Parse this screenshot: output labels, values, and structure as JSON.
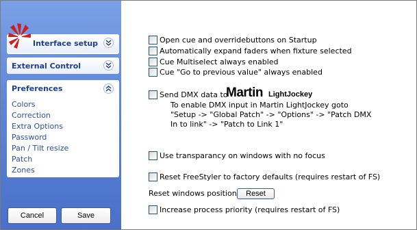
{
  "sidebar": {
    "panels": {
      "interface": {
        "title": "Interface setup",
        "expanded": false
      },
      "external": {
        "title": "External Control",
        "expanded": false
      },
      "preferences": {
        "title": "Preferences",
        "expanded": true,
        "items": [
          "Colors",
          "Correction",
          "Extra Options",
          "Password",
          "Pan / Tilt resize",
          "Patch",
          "Zones"
        ]
      }
    },
    "buttons": {
      "cancel": "Cancel",
      "save": "Save"
    }
  },
  "options": [
    {
      "label": "Open cue and overridebuttons on Startup",
      "checked": false
    },
    {
      "label": "Automatically expand faders when fixture selected",
      "checked": false
    },
    {
      "label": "Cue Multiselect always enabled",
      "checked": false
    },
    {
      "label": "Cue \"Go to previous value\" always enabled",
      "checked": false
    },
    {
      "label": "Send DMX data to",
      "checked": false
    },
    {
      "label": "Use transparancy on windows with no focus",
      "checked": false
    },
    {
      "label": "Reset FreeStyler to factory defaults (requires restart of FS)",
      "checked": false
    },
    {
      "label": "Increase process priority (requires restart of FS)",
      "checked": false
    }
  ],
  "dmx": {
    "logo_brand": "Martin",
    "logo_product": "LightJockey",
    "info_lines": [
      "To enable DMX input in Martin LightJockey goto",
      "\"Setup -> \"Global Patch\" -> \"Options\" -> \"Patch DMX",
      "In to link\" -> \"Patch to Link 1\""
    ]
  },
  "reset_windows": {
    "label": "Reset windows positions",
    "button": "Reset"
  },
  "colors": {
    "sidebar_top": "#7aa1e6",
    "sidebar_bottom": "#4a70c9",
    "panel_title": "#1a3f8f",
    "link": "#2b4f9f"
  }
}
